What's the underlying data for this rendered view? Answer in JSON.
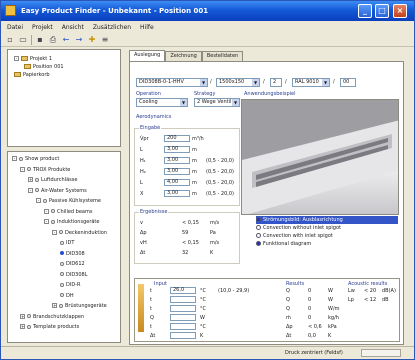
{
  "window": {
    "title": "Easy Product Finder - Unbekannt - Position 001"
  },
  "menu": [
    "Datei",
    "Projekt",
    "Ansicht",
    "Zusätzlichen",
    "Hilfe"
  ],
  "project_tree": [
    {
      "label": "Projekt 1",
      "level": 0,
      "toggle": "-"
    },
    {
      "label": "Position 001",
      "level": 1,
      "toggle": ""
    },
    {
      "label": "Papierkorb",
      "level": 0,
      "toggle": ""
    }
  ],
  "product_tree": [
    {
      "label": "Show product",
      "level": 0,
      "toggle": "-",
      "kind": "dot"
    },
    {
      "label": "TROX Produkte",
      "level": 1,
      "toggle": "-",
      "kind": "dot"
    },
    {
      "label": "Luftdurchlässe",
      "level": 2,
      "toggle": "+",
      "kind": "dot"
    },
    {
      "label": "Air-Water Systems",
      "level": 2,
      "toggle": "-",
      "kind": "dot"
    },
    {
      "label": "Passive Kühlsysteme",
      "level": 3,
      "toggle": "-",
      "kind": "dot"
    },
    {
      "label": "Chilled beams",
      "level": 4,
      "toggle": "-",
      "kind": "dot"
    },
    {
      "label": "Induktionsgeräte",
      "level": 4,
      "toggle": "-",
      "kind": "dot"
    },
    {
      "label": "Deckeninduktion",
      "level": 5,
      "toggle": "-",
      "kind": "dot"
    },
    {
      "label": "IDT",
      "level": 6,
      "toggle": "",
      "kind": "dot"
    },
    {
      "label": "DID308",
      "level": 6,
      "toggle": "",
      "kind": "sel"
    },
    {
      "label": "DID612",
      "level": 6,
      "toggle": "",
      "kind": "dot"
    },
    {
      "label": "DID308L",
      "level": 6,
      "toggle": "",
      "kind": "dot"
    },
    {
      "label": "DID-R",
      "level": 6,
      "toggle": "",
      "kind": "dot"
    },
    {
      "label": "DH",
      "level": 6,
      "toggle": "",
      "kind": "dot"
    },
    {
      "label": "Brüstungsgeräte",
      "level": 5,
      "toggle": "+",
      "kind": "dot"
    },
    {
      "label": "Brandschutzklappen",
      "level": 1,
      "toggle": "+",
      "kind": "dot"
    },
    {
      "label": "Template products",
      "level": 1,
      "toggle": "+",
      "kind": "dot"
    }
  ],
  "tabs": [
    "Auslegung",
    "Zeichnung",
    "Bestelldaten"
  ],
  "model": {
    "code": "DID308B-0-1-HHV",
    "size": "1500x150",
    "n1": "2",
    "color": "RAL 9010",
    "n2": "00"
  },
  "operation": {
    "label": "Operation",
    "value": "Cooling"
  },
  "strategy": {
    "label": "Strategy",
    "value": "2 Wege Ventil"
  },
  "image_caption": "Anwendungsbeispiel",
  "air_section": "Aerodynamics",
  "input_label": "Eingabe",
  "air_inputs": [
    {
      "sym": "V̇pr",
      "val": "200",
      "unit": "m³/h",
      "range": ""
    },
    {
      "sym": "L",
      "val": "3,00",
      "unit": "m",
      "range": ""
    },
    {
      "sym": "H₁",
      "val": "3,00",
      "unit": "m",
      "range": "(0,5 - 20,0)"
    },
    {
      "sym": "H₂",
      "val": "3,00",
      "unit": "m",
      "range": "(0,5 - 20,0)"
    },
    {
      "sym": "L",
      "val": "4,00",
      "unit": "m",
      "range": "(0,5 - 20,0)"
    },
    {
      "sym": "X",
      "val": "3,00",
      "unit": "m",
      "range": "(0,5 - 20,0)"
    }
  ],
  "results_label": "Ergebnisse",
  "air_results": [
    {
      "sym": "v",
      "val": "< 0,15",
      "unit": "m/s"
    },
    {
      "sym": "Δp",
      "val": "59",
      "unit": "Pa"
    },
    {
      "sym": "vH",
      "val": "< 0,15",
      "unit": "m/s"
    },
    {
      "sym": "Δt",
      "val": "32",
      "unit": "K"
    }
  ],
  "options": [
    {
      "label": "Strömungsbild: Ausblasrichtung",
      "on": true
    },
    {
      "label": "Convection without inlet spigot",
      "on": false
    },
    {
      "label": "Convection with inlet spigot",
      "on": false
    },
    {
      "label": "Funktional diagram",
      "on": true
    }
  ],
  "thermal": {
    "input_label": "Input",
    "inputs": [
      {
        "sym": "t",
        "val": "26,0",
        "unit": "°C",
        "range": "(10,0 - 29,9)"
      },
      {
        "sym": "t",
        "val": "",
        "unit": "°C",
        "range": ""
      },
      {
        "sym": "t",
        "val": "",
        "unit": "°C",
        "range": ""
      },
      {
        "sym": "Q",
        "val": "",
        "unit": "W",
        "range": ""
      },
      {
        "sym": "t",
        "val": "",
        "unit": "°C",
        "range": ""
      },
      {
        "sym": "Δt",
        "val": "",
        "unit": "K",
        "range": ""
      }
    ],
    "results_label": "Results",
    "results": [
      {
        "sym": "Q",
        "val": "0",
        "unit": "W"
      },
      {
        "sym": "Q",
        "val": "0",
        "unit": "W"
      },
      {
        "sym": "Q",
        "val": "0",
        "unit": "W/m"
      },
      {
        "sym": "ṁ",
        "val": "0",
        "unit": "kg/h"
      },
      {
        "sym": "Δp",
        "val": "< 0,6",
        "unit": "kPa"
      },
      {
        "sym": "Δt",
        "val": "0,0",
        "unit": "K"
      }
    ],
    "acoustic_label": "Acoustic results",
    "acoustic": [
      {
        "sym": "Lw",
        "val": "< 20",
        "unit": "dB(A)"
      },
      {
        "sym": "Lp",
        "val": "< 12",
        "unit": "dB"
      }
    ]
  },
  "status": {
    "text": "Druck zentriert (Feldsf)"
  }
}
